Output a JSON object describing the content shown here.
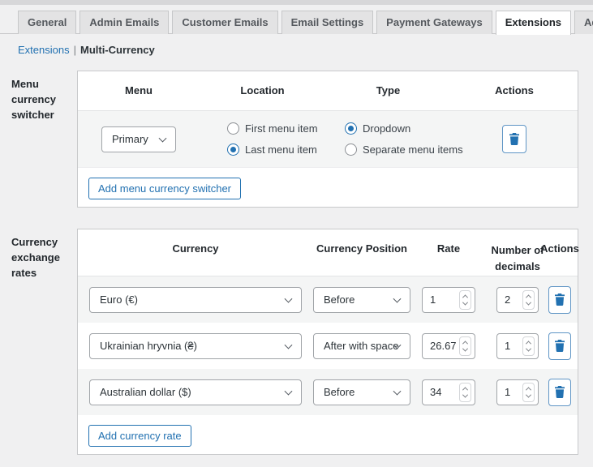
{
  "colors": {
    "accent_blue": "#2271b1",
    "page_bg": "#f0f0f1",
    "stripe": "#f4f5f5"
  },
  "tabs": [
    {
      "label": "General",
      "active": false
    },
    {
      "label": "Admin Emails",
      "active": false
    },
    {
      "label": "Customer Emails",
      "active": false
    },
    {
      "label": "Email Settings",
      "active": false
    },
    {
      "label": "Payment Gateways",
      "active": false
    },
    {
      "label": "Extensions",
      "active": true
    },
    {
      "label": "Advanced",
      "active": false
    }
  ],
  "breadcrumb": {
    "link": "Extensions",
    "separator": "|",
    "current": "Multi-Currency"
  },
  "menu_switcher": {
    "section_label": "Menu currency switcher",
    "headers": {
      "menu": "Menu",
      "location": "Location",
      "type": "Type",
      "actions": "Actions"
    },
    "row": {
      "menu_value": "Primary",
      "location_options": [
        {
          "label": "First menu item",
          "selected": false
        },
        {
          "label": "Last menu item",
          "selected": true
        }
      ],
      "type_options": [
        {
          "label": "Dropdown",
          "selected": true
        },
        {
          "label": "Separate menu items",
          "selected": false
        }
      ]
    },
    "add_button": "Add menu currency switcher"
  },
  "currency_rates": {
    "section_label": "Currency exchange rates",
    "headers": {
      "currency": "Currency",
      "position": "Currency Position",
      "rate": "Rate",
      "decimals": "Number of decimals",
      "actions": "Actions"
    },
    "rows": [
      {
        "currency": "Euro (€)",
        "position": "Before",
        "rate": "1",
        "decimals": "2"
      },
      {
        "currency": "Ukrainian hryvnia (₴)",
        "position": "After with space",
        "rate": "26.67",
        "decimals": "1"
      },
      {
        "currency": "Australian dollar ($)",
        "position": "Before",
        "rate": "34",
        "decimals": "1"
      }
    ],
    "add_button": "Add currency rate"
  }
}
